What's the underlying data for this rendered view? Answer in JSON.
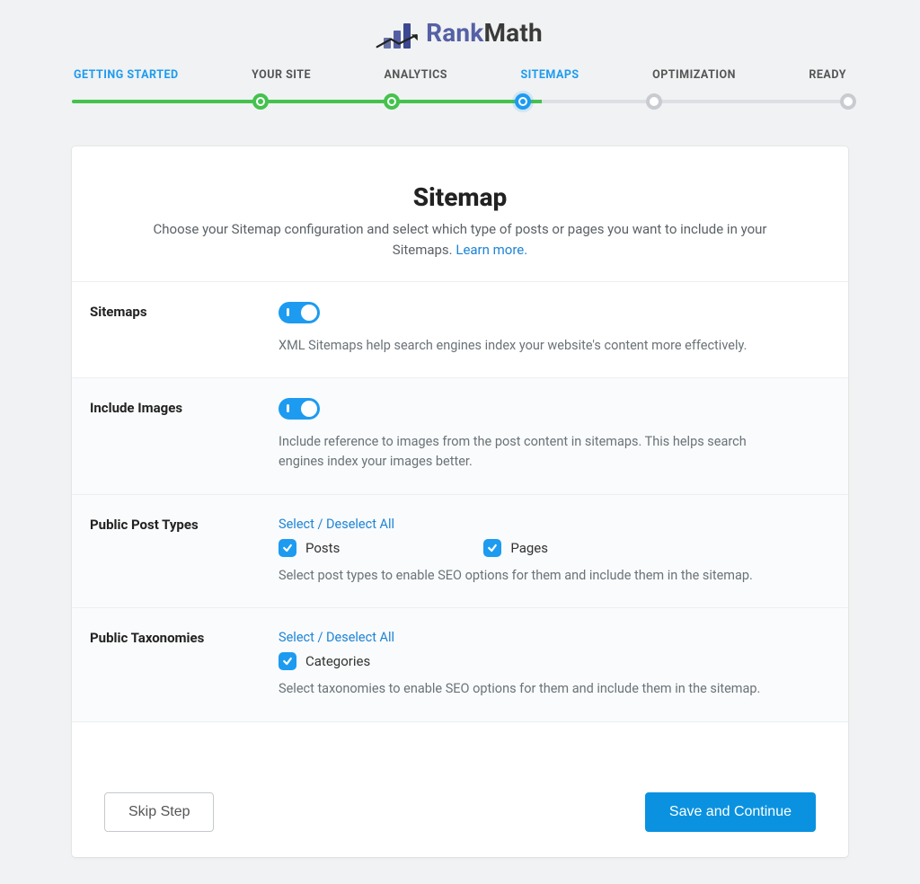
{
  "brand": {
    "name_a": "Rank",
    "name_b": "Math"
  },
  "stepper": {
    "steps": [
      {
        "label": "GETTING STARTED",
        "state": "done-label"
      },
      {
        "label": "YOUR SITE",
        "state": "done"
      },
      {
        "label": "ANALYTICS",
        "state": "done"
      },
      {
        "label": "SITEMAPS",
        "state": "current"
      },
      {
        "label": "OPTIMIZATION",
        "state": "pending"
      },
      {
        "label": "READY",
        "state": "pending"
      }
    ]
  },
  "page": {
    "title": "Sitemap",
    "subtitle_a": "Choose your Sitemap configuration and select which type of posts or pages you want to include in your Sitemaps. ",
    "learn_more": "Learn more."
  },
  "rows": {
    "sitemaps": {
      "label": "Sitemaps",
      "help": "XML Sitemaps help search engines index your website's content more effectively.",
      "toggle_on": true
    },
    "images": {
      "label": "Include Images",
      "help": "Include reference to images from the post content in sitemaps. This helps search engines index your images better.",
      "toggle_on": true
    },
    "post_types": {
      "label": "Public Post Types",
      "select_all": "Select / Deselect All",
      "items": [
        {
          "label": "Posts",
          "checked": true
        },
        {
          "label": "Pages",
          "checked": true
        }
      ],
      "help": "Select post types to enable SEO options for them and include them in the sitemap."
    },
    "taxonomies": {
      "label": "Public Taxonomies",
      "select_all": "Select / Deselect All",
      "items": [
        {
          "label": "Categories",
          "checked": true
        }
      ],
      "help": "Select taxonomies to enable SEO options for them and include them in the sitemap."
    }
  },
  "actions": {
    "skip": "Skip Step",
    "save": "Save and Continue"
  }
}
